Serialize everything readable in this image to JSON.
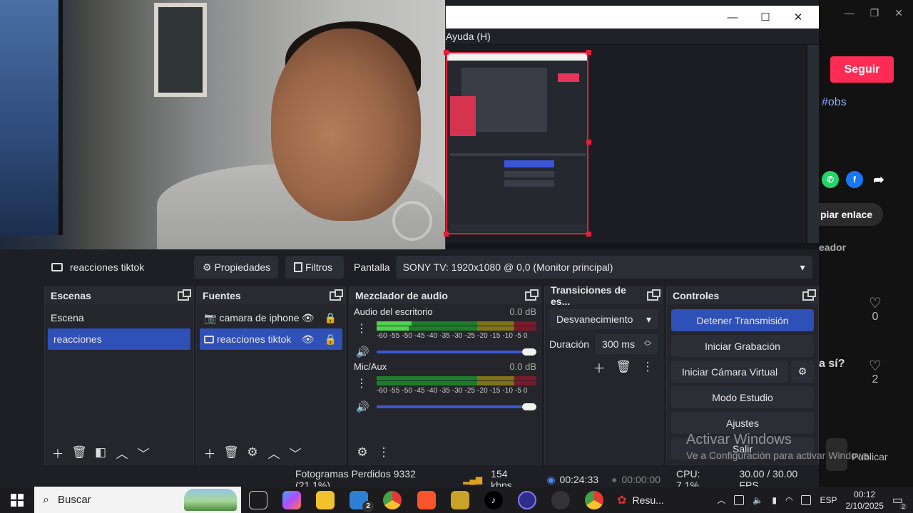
{
  "preview_window": {
    "menu_text": "Ayuda (H)",
    "minimize": "—",
    "maximize": "☐",
    "close": "✕"
  },
  "browser": {
    "follow_label": "Seguir",
    "hashtag": "#obs",
    "copy_link": "piar enlace",
    "creator": "eador",
    "likes": [
      "0",
      "2"
    ],
    "question_fragment": "a sí?",
    "publish_fragment": "Publicar"
  },
  "obs": {
    "current_source": "reacciones tiktok",
    "properties_label": "Propiedades",
    "filters_label": "Filtros",
    "screen_label": "Pantalla",
    "screen_value": "SONY TV: 1920x1080 @ 0,0 (Monitor principal)",
    "scenes": {
      "title": "Escenas",
      "items": [
        "Escena",
        "reacciones"
      ],
      "selected_index": 1
    },
    "sources": {
      "title": "Fuentes",
      "items": [
        "camara de iphone",
        "reacciones tiktok"
      ],
      "selected_index": 1
    },
    "mixer": {
      "title": "Mezclador de audio",
      "channels": [
        {
          "name": "Audio del escritorio",
          "db": "0.0 dB",
          "level": 0.22
        },
        {
          "name": "Mic/Aux",
          "db": "0.0 dB",
          "level": 0.0
        }
      ],
      "scale": "-60 -55 -50 -45 -40 -35 -30 -25 -20 -15 -10  -5   0"
    },
    "transitions": {
      "title": "Transiciones de es...",
      "selected": "Desvanecimiento",
      "duration_label": "Duración",
      "duration_value": "300 ms"
    },
    "controls": {
      "title": "Controles",
      "buttons": [
        "Detener Transmisión",
        "Iniciar Grabación",
        "Iniciar Cámara Virtual",
        "Modo Estudio",
        "Ajustes",
        "Salir"
      ]
    },
    "status": {
      "dropped_frames": "Fotogramas Perdidos 9332 (21.1%)",
      "bitrate": "154 kbps",
      "stream_time": "00:24:33",
      "rec_time": "00:00:00",
      "cpu": "CPU: 7.1%",
      "fps": "30.00 / 30.00 FPS"
    }
  },
  "windows_overlay": {
    "title": "Activar Windows",
    "subtitle": "Ve a Configuración para activar Windows."
  },
  "taskbar": {
    "search_placeholder": "Buscar",
    "mail_badge": "2",
    "resume_label": "Resu...",
    "language": "ESP",
    "time": "00:12",
    "date": "2/10/2025",
    "notif_badge": "2"
  }
}
